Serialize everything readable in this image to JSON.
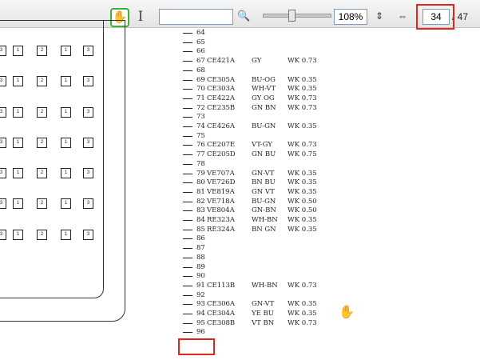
{
  "toolbar": {
    "tools": {
      "hand_icon": "hand-icon",
      "select_icon": "text-select-icon"
    },
    "search": {
      "value": "",
      "placeholder": "",
      "icon": "search-icon"
    },
    "zoom": {
      "level": "108%",
      "slider_fraction": 0.4
    },
    "fit_icons": [
      "fit-height-icon",
      "fit-width-icon"
    ],
    "page": {
      "current": "34",
      "total": "/ 47"
    },
    "highlight_color": "#e3241c",
    "active_tool_color": "#3bb13b"
  },
  "connector": {
    "pin_labels": [
      "3",
      "1",
      "2",
      "1"
    ]
  },
  "pinout": [
    {
      "num": "64",
      "part": "",
      "color": "",
      "wk": ""
    },
    {
      "num": "65",
      "part": "",
      "color": "",
      "wk": ""
    },
    {
      "num": "66",
      "part": "",
      "color": "",
      "wk": ""
    },
    {
      "num": "67",
      "part": "CE421A",
      "color": "GY",
      "wk": "WK 0.73"
    },
    {
      "num": "68",
      "part": "",
      "color": "",
      "wk": ""
    },
    {
      "num": "69",
      "part": "CE305A",
      "color": "BU-OG",
      "wk": "WK 0.35"
    },
    {
      "num": "70",
      "part": "CE303A",
      "color": "WH-VT",
      "wk": "WK 0.35"
    },
    {
      "num": "71",
      "part": "CE422A",
      "color": "GY OG",
      "wk": "WK 0.73"
    },
    {
      "num": "72",
      "part": "CE235B",
      "color": "GN BN",
      "wk": "WK 0.73"
    },
    {
      "num": "73",
      "part": "",
      "color": "",
      "wk": ""
    },
    {
      "num": "74",
      "part": "CE426A",
      "color": "BU-GN",
      "wk": "WK 0.35"
    },
    {
      "num": "75",
      "part": "",
      "color": "",
      "wk": ""
    },
    {
      "num": "76",
      "part": "CE207E",
      "color": "VT-GY",
      "wk": "WK 0.73"
    },
    {
      "num": "77",
      "part": "CE205D",
      "color": "GN BU",
      "wk": "WK 0.75"
    },
    {
      "num": "78",
      "part": "",
      "color": "",
      "wk": ""
    },
    {
      "num": "79",
      "part": "VE707A",
      "color": "GN-VT",
      "wk": "WK 0.35"
    },
    {
      "num": "80",
      "part": "VE726D",
      "color": "BN BU",
      "wk": "WK 0.35"
    },
    {
      "num": "81",
      "part": "VE819A",
      "color": "GN VT",
      "wk": "WK 0.35"
    },
    {
      "num": "82",
      "part": "VE718A",
      "color": "BU-GN",
      "wk": "WK 0.50"
    },
    {
      "num": "83",
      "part": "VE804A",
      "color": "GN-BN",
      "wk": "WK 0.50"
    },
    {
      "num": "84",
      "part": "RE323A",
      "color": "WH-BN",
      "wk": "WK 0.35"
    },
    {
      "num": "85",
      "part": "RE324A",
      "color": "BN GN",
      "wk": "WK 0.35"
    },
    {
      "num": "86",
      "part": "",
      "color": "",
      "wk": ""
    },
    {
      "num": "87",
      "part": "",
      "color": "",
      "wk": ""
    },
    {
      "num": "88",
      "part": "",
      "color": "",
      "wk": ""
    },
    {
      "num": "89",
      "part": "",
      "color": "",
      "wk": ""
    },
    {
      "num": "90",
      "part": "",
      "color": "",
      "wk": ""
    },
    {
      "num": "91",
      "part": "CE113B",
      "color": "WH-BN",
      "wk": "WK 0.73"
    },
    {
      "num": "92",
      "part": "",
      "color": "",
      "wk": ""
    },
    {
      "num": "93",
      "part": "CE306A",
      "color": "GN-VT",
      "wk": "WK 0.35"
    },
    {
      "num": "94",
      "part": "CE304A",
      "color": "YE BU",
      "wk": "WK 0.35"
    },
    {
      "num": "95",
      "part": "CE308B",
      "color": "VT BN",
      "wk": "WK 0.73"
    },
    {
      "num": "96",
      "part": "",
      "color": "",
      "wk": ""
    }
  ],
  "cursor_icon": "hand-cursor-icon"
}
